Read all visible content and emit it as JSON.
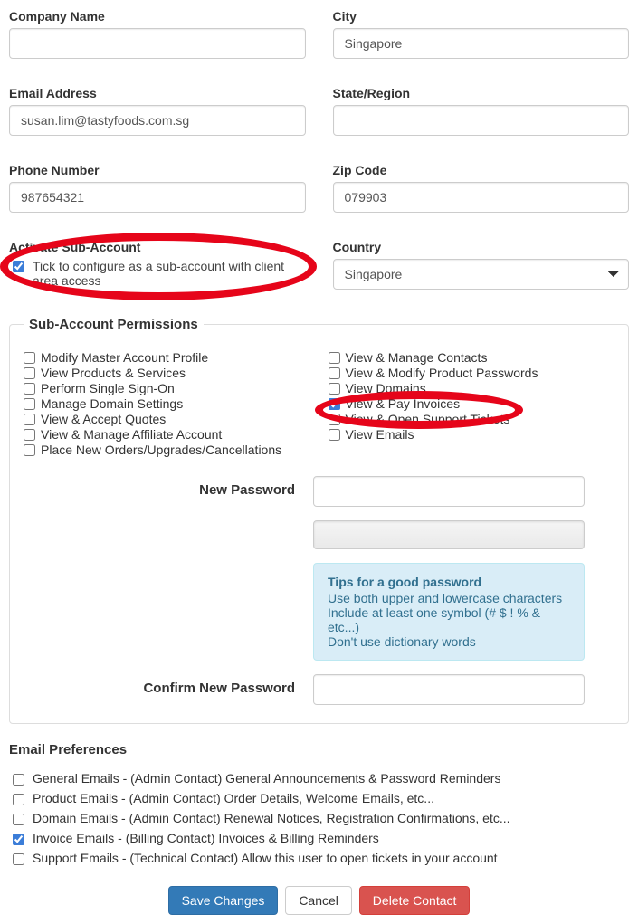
{
  "left_fields": {
    "company_label": "Company Name",
    "company_value": "",
    "email_label": "Email Address",
    "email_value": "susan.lim@tastyfoods.com.sg",
    "phone_label": "Phone Number",
    "phone_value": "987654321",
    "activate_label": "Activate Sub-Account",
    "activate_checkbox_label": "Tick to configure as a sub-account with client area access"
  },
  "right_fields": {
    "city_label": "City",
    "city_value": "Singapore",
    "state_label": "State/Region",
    "state_value": "",
    "zip_label": "Zip Code",
    "zip_value": "079903",
    "country_label": "Country",
    "country_value": "Singapore"
  },
  "permissions": {
    "title": "Sub-Account Permissions",
    "left": [
      {
        "label": "Modify Master Account Profile",
        "checked": false
      },
      {
        "label": "View Products & Services",
        "checked": false
      },
      {
        "label": "Perform Single Sign-On",
        "checked": false
      },
      {
        "label": "Manage Domain Settings",
        "checked": false
      },
      {
        "label": "View & Accept Quotes",
        "checked": false
      },
      {
        "label": "View & Manage Affiliate Account",
        "checked": false
      },
      {
        "label": "Place New Orders/Upgrades/Cancellations",
        "checked": false
      }
    ],
    "right": [
      {
        "label": "View & Manage Contacts",
        "checked": false
      },
      {
        "label": "View & Modify Product Passwords",
        "checked": false
      },
      {
        "label": "View Domains",
        "checked": false
      },
      {
        "label": "View & Pay Invoices",
        "checked": true
      },
      {
        "label": "View & Open Support Tickets",
        "checked": false
      },
      {
        "label": "View Emails",
        "checked": false
      }
    ],
    "new_password_label": "New Password",
    "confirm_password_label": "Confirm New Password",
    "tips_title": "Tips for a good password",
    "tips_line1": "Use both upper and lowercase characters",
    "tips_line2": "Include at least one symbol (# $ ! % & etc...)",
    "tips_line3": "Don't use dictionary words"
  },
  "email_prefs": {
    "title": "Email Preferences",
    "items": [
      {
        "label": "General Emails - (Admin Contact) General Announcements & Password Reminders",
        "checked": false
      },
      {
        "label": "Product Emails - (Admin Contact) Order Details, Welcome Emails, etc...",
        "checked": false
      },
      {
        "label": "Domain Emails - (Admin Contact) Renewal Notices, Registration Confirmations, etc...",
        "checked": false
      },
      {
        "label": "Invoice Emails - (Billing Contact) Invoices & Billing Reminders",
        "checked": true
      },
      {
        "label": "Support Emails - (Technical Contact) Allow this user to open tickets in your account",
        "checked": false
      }
    ]
  },
  "buttons": {
    "save": "Save Changes",
    "cancel": "Cancel",
    "delete": "Delete Contact"
  },
  "annotations": {
    "color": "#e6051a",
    "circles": [
      "activate-subaccount-section",
      "view-pay-invoices-permission"
    ]
  }
}
